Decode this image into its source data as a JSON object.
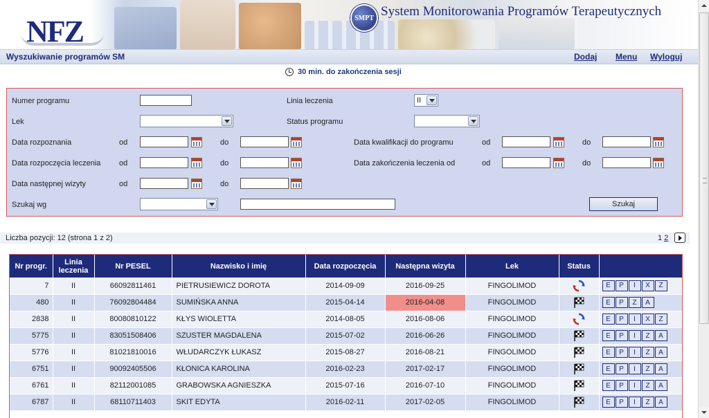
{
  "header": {
    "logo_text": "NFZ",
    "badge_text": "SMPT",
    "system_title": "System Monitorowania Programów Terapeutycznych"
  },
  "titlebar": {
    "title": "Wyszukiwanie programów SM",
    "nav": {
      "add": "Dodaj",
      "menu": "Menu",
      "logout": "Wyloguj"
    }
  },
  "session": {
    "text": "30 min. do zakończenia sesji"
  },
  "form": {
    "numer_programu": {
      "label": "Numer programu",
      "value": ""
    },
    "linia_leczenia": {
      "label": "Linia leczenia",
      "value": "II"
    },
    "lek": {
      "label": "Lek",
      "value": ""
    },
    "status_programu": {
      "label": "Status programu",
      "value": ""
    },
    "data_rozpoznania": {
      "label": "Data rozpoznania"
    },
    "data_kwalifikacji": {
      "label": "Data kwalifikacji do programu"
    },
    "data_rozpoczecia": {
      "label": "Data rozpoczęcia leczenia"
    },
    "data_zakonczenia": {
      "label": "Data zakończenia leczenia od"
    },
    "data_nastepnej": {
      "label": "Data następnej wizyty"
    },
    "szukaj_wg": {
      "label": "Szukaj wg",
      "value": "",
      "text_value": ""
    },
    "od": "od",
    "do": "do",
    "search_button": "Szukaj"
  },
  "results": {
    "count_text": "Liczba pozycji: 12  (strona 1 z 2)",
    "pages": [
      "1",
      "2"
    ]
  },
  "table": {
    "headers": {
      "nr": "Nr progr.",
      "linia": "Linia leczenia",
      "pesel": "Nr PESEL",
      "name": "Nazwisko i imię",
      "start": "Data rozpoczęcia",
      "next": "Następna wizyta",
      "drug": "Lek",
      "status": "Status"
    },
    "rows": [
      {
        "nr": "7",
        "linia": "II",
        "pesel": "66092811461",
        "name": "PIETRUSIEWICZ DOROTA",
        "start": "2014-09-09",
        "next": "2016-09-25",
        "drug": "FINGOLIMOD",
        "status": "refresh-icon",
        "actions": [
          "E",
          "P",
          "I",
          "X",
          "Z"
        ],
        "highlight": false
      },
      {
        "nr": "480",
        "linia": "II",
        "pesel": "76092804484",
        "name": "SUMIŃSKA ANNA",
        "start": "2015-04-14",
        "next": "2016-04-08",
        "drug": "FINGOLIMOD",
        "status": "checkered-flag-icon",
        "actions": [
          "E",
          "P",
          "Z",
          "A"
        ],
        "highlight": true
      },
      {
        "nr": "2838",
        "linia": "II",
        "pesel": "80080810122",
        "name": "KŁYS WIOLETTA",
        "start": "2014-08-05",
        "next": "2016-08-06",
        "drug": "FINGOLIMOD",
        "status": "refresh-icon",
        "actions": [
          "E",
          "P",
          "I",
          "X",
          "Z"
        ],
        "highlight": false
      },
      {
        "nr": "5775",
        "linia": "II",
        "pesel": "83051508406",
        "name": "SZUSTER MAGDALENA",
        "start": "2015-07-02",
        "next": "2016-06-26",
        "drug": "FINGOLIMOD",
        "status": "checkered-flag-icon",
        "actions": [
          "E",
          "P",
          "I",
          "Z",
          "A"
        ],
        "highlight": false
      },
      {
        "nr": "5776",
        "linia": "II",
        "pesel": "81021810016",
        "name": "WŁUDARCZYK ŁUKASZ",
        "start": "2015-08-27",
        "next": "2016-08-21",
        "drug": "FINGOLIMOD",
        "status": "checkered-flag-icon",
        "actions": [
          "E",
          "P",
          "I",
          "Z",
          "A"
        ],
        "highlight": false
      },
      {
        "nr": "6751",
        "linia": "II",
        "pesel": "90092405506",
        "name": "KŁONICA KAROLINA",
        "start": "2016-02-23",
        "next": "2017-02-17",
        "drug": "FINGOLIMOD",
        "status": "checkered-flag-icon",
        "actions": [
          "E",
          "P",
          "I",
          "Z",
          "A"
        ],
        "highlight": false
      },
      {
        "nr": "6761",
        "linia": "II",
        "pesel": "82112001085",
        "name": "GRABOWSKA AGNIESZKA",
        "start": "2015-07-16",
        "next": "2016-07-10",
        "drug": "FINGOLIMOD",
        "status": "checkered-flag-icon",
        "actions": [
          "E",
          "P",
          "I",
          "Z",
          "A"
        ],
        "highlight": false
      },
      {
        "nr": "6787",
        "linia": "II",
        "pesel": "68110711403",
        "name": "SKIT EDYTA",
        "start": "2016-02-11",
        "next": "2017-02-05",
        "drug": "FINGOLIMOD",
        "status": "checkered-flag-icon",
        "actions": [
          "E",
          "P",
          "I",
          "Z",
          "A"
        ],
        "highlight": false
      }
    ]
  },
  "colors": {
    "navy": "#1d2b7a",
    "form_bg": "#d0d7ee",
    "form_border": "#d65a5a",
    "row_odd": "#eef1f8",
    "row_even": "#d6ddf0",
    "overdue": "#f08e8a"
  }
}
